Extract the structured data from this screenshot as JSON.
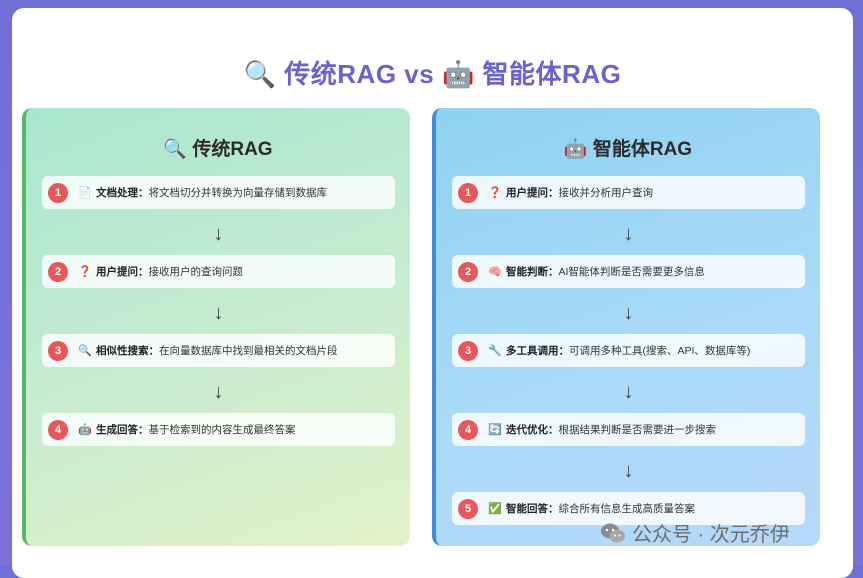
{
  "title": {
    "icon": "🔍",
    "left": "传统RAG",
    "vs": "vs",
    "icon2": "🤖",
    "right": "智能体RAG"
  },
  "left_panel": {
    "icon": "🔍",
    "title": "传统RAG",
    "steps": [
      {
        "num": "1",
        "icon": "📄",
        "label": "文档处理：",
        "text": "将文档切分并转换为向量存储到数据库"
      },
      {
        "num": "2",
        "icon": "❓",
        "label": "用户提问：",
        "text": "接收用户的查询问题"
      },
      {
        "num": "3",
        "icon": "🔍",
        "label": "相似性搜索：",
        "text": "在向量数据库中找到最相关的文档片段"
      },
      {
        "num": "4",
        "icon": "🤖",
        "label": "生成回答：",
        "text": "基于检索到的内容生成最终答案"
      }
    ]
  },
  "right_panel": {
    "icon": "🤖",
    "title": "智能体RAG",
    "steps": [
      {
        "num": "1",
        "icon": "❓",
        "label": "用户提问：",
        "text": "接收并分析用户查询"
      },
      {
        "num": "2",
        "icon": "🧠",
        "label": "智能判断：",
        "text": "AI智能体判断是否需要更多信息"
      },
      {
        "num": "3",
        "icon": "🔧",
        "label": "多工具调用：",
        "text": "可调用多种工具(搜索、API、数据库等)"
      },
      {
        "num": "4",
        "icon": "🔄",
        "label": "迭代优化：",
        "text": "根据结果判断是否需要进一步搜索"
      },
      {
        "num": "5",
        "icon": "✅",
        "label": "智能回答：",
        "text": "综合所有信息生成高质量答案"
      }
    ]
  },
  "arrow": "↓",
  "watermark": {
    "text": "公众号 · 次元乔伊",
    "icon": "wechat-icon"
  }
}
